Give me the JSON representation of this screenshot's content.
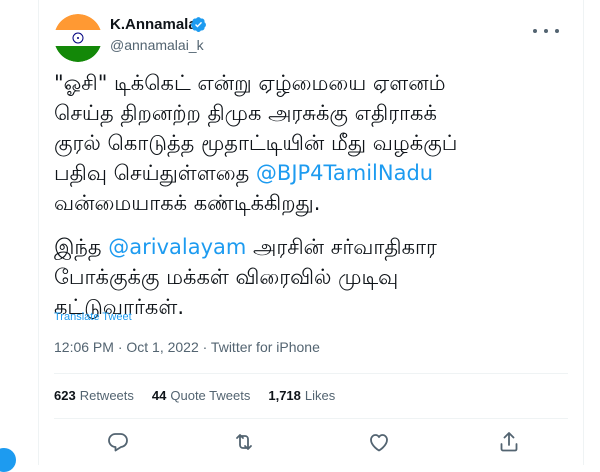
{
  "author": {
    "display_name": "K.Annamalai",
    "handle": "@annamalai_k"
  },
  "tweet": {
    "lines_p1": [
      {
        "text": "\"ஓசி\" டிக்கெட் என்று ஏழ்மையை ஏளனம்"
      },
      {
        "text": "செய்த திறனற்ற திமுக அரசுக்கு எதிராகக்"
      },
      {
        "text": "குரல் கொடுத்த மூதாட்டியின் மீது வழக்குப்"
      },
      {
        "pre": "பதிவு செய்துள்ளதை ",
        "mention": "@BJP4TamilNadu"
      },
      {
        "text": "வன்மையாகக் கண்டிக்கிறது."
      }
    ],
    "lines_p2": [
      {
        "pre": "இந்த ",
        "mention": "@arivalayam",
        "post": " அரசின் சர்வாதிகார"
      },
      {
        "text": "போக்குக்கு மக்கள் விரைவில் முடிவு"
      },
      {
        "text": "கட்டுவார்கள்."
      }
    ],
    "translate_label": "Translate Tweet",
    "timestamp": "12:06 PM · Oct 1, 2022 · Twitter for iPhone"
  },
  "stats": {
    "retweets_count": "623",
    "retweets_label": "Retweets",
    "quotes_count": "44",
    "quotes_label": "Quote Tweets",
    "likes_count": "1,718",
    "likes_label": "Likes"
  },
  "colors": {
    "accent": "#1d9bf0",
    "text": "#0f1419",
    "muted": "#536471",
    "border": "#eff3f4",
    "flag_saffron": "#ff9933",
    "flag_green": "#138808",
    "flag_chakra": "#000080"
  },
  "icons": {
    "verified": "verified-badge-icon",
    "more": "more-horizontal-icon",
    "reply": "reply-icon",
    "retweet": "retweet-icon",
    "like": "heart-icon",
    "share": "share-icon"
  }
}
